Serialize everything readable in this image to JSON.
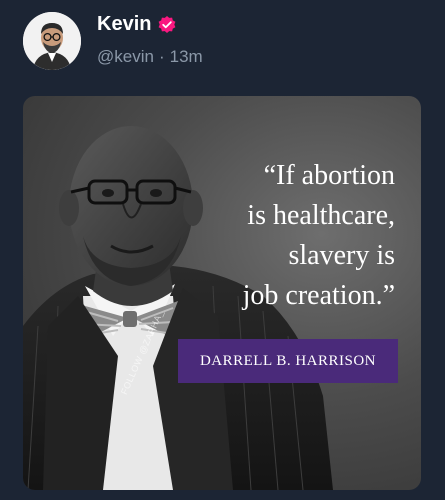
{
  "post": {
    "author_name": "Kevin",
    "handle": "@kevin",
    "separator": "·",
    "time_ago": "13m",
    "verified_icon": "verified-badge-icon",
    "avatar_icon": "profile-avatar-icon"
  },
  "image": {
    "quote": "“If abortion\nis healthcare,\nslavery is\njob creation.”",
    "attribution": "DARRELL B.  HARRISON",
    "watermark": "FOLLOW @ZAPHA_",
    "banner_color": "#4a2a7a",
    "accent_color": "#f91880"
  }
}
